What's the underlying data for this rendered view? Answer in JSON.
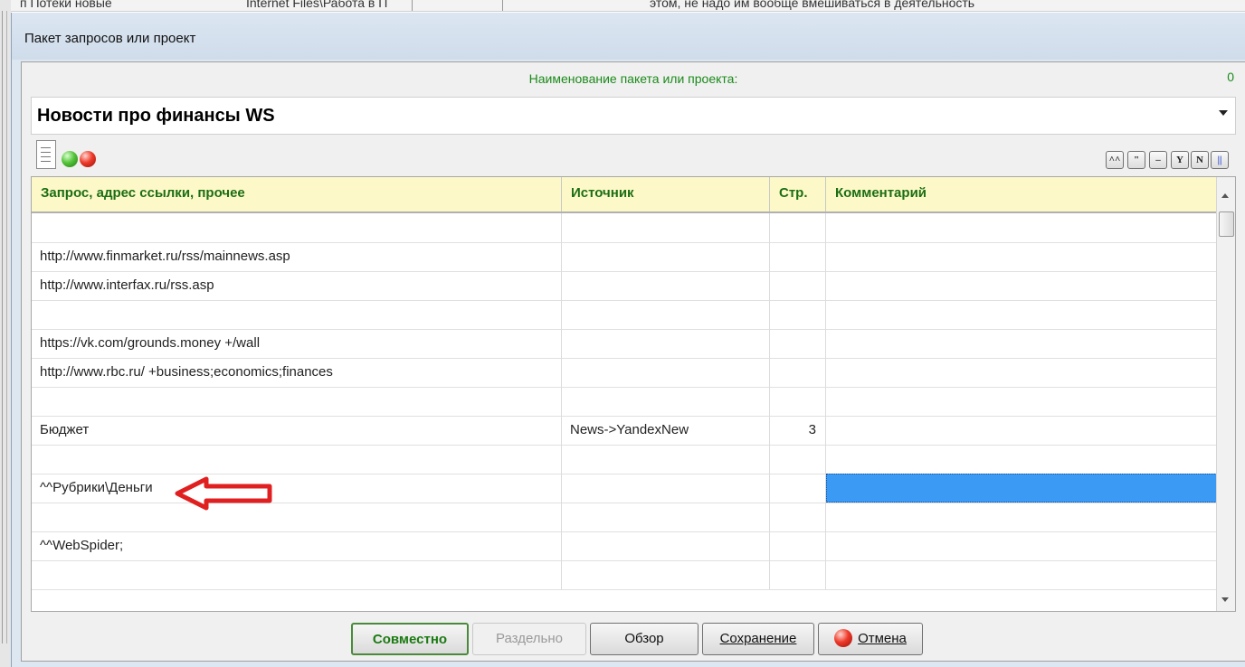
{
  "background": {
    "strip": [
      {
        "text": "п Потеки новые"
      },
      {
        "text": "Internet Files\\Работа в П"
      },
      {
        "text": "этом, не надо им вообще вмешиваться в деятельность"
      }
    ]
  },
  "window": {
    "title": "Пакет запросов или проект"
  },
  "header": {
    "name_label": "Наименование пакета или проекта:",
    "counter": "0"
  },
  "project_combo": {
    "value": "Новости про финансы WS"
  },
  "toolbar_right": [
    {
      "label": "^^",
      "icon": "caret-caret-icon"
    },
    {
      "label": "\"",
      "icon": "quote-icon"
    },
    {
      "label": "–",
      "icon": "minus-icon"
    },
    {
      "label": "Y",
      "icon": "y-icon"
    },
    {
      "label": "N",
      "icon": "n-icon"
    },
    {
      "label": "||",
      "icon": "pause-icon"
    }
  ],
  "grid": {
    "columns": [
      "Запрос, адрес ссылки, прочее",
      "Источник",
      "Стр.",
      "Комментарий"
    ],
    "rows": [
      {
        "query": "",
        "source": "",
        "page": "",
        "comment": ""
      },
      {
        "query": "http://www.finmarket.ru/rss/mainnews.asp",
        "source": "",
        "page": "",
        "comment": ""
      },
      {
        "query": "http://www.interfax.ru/rss.asp",
        "source": "",
        "page": "",
        "comment": ""
      },
      {
        "query": "",
        "source": "",
        "page": "",
        "comment": ""
      },
      {
        "query": "https://vk.com/grounds.money +/wall",
        "source": "",
        "page": "",
        "comment": ""
      },
      {
        "query": "http://www.rbc.ru/ +business;economics;finances",
        "source": "",
        "page": "",
        "comment": ""
      },
      {
        "query": "",
        "source": "",
        "page": "",
        "comment": ""
      },
      {
        "query": "Бюджет",
        "source": "News->YandexNew",
        "page": "3",
        "comment": ""
      },
      {
        "query": "",
        "source": "",
        "page": "",
        "comment": ""
      },
      {
        "query": "^^Рубрики\\Деньги",
        "source": "",
        "page": "",
        "comment": "",
        "selected_comment": true
      },
      {
        "query": "",
        "source": "",
        "page": "",
        "comment": ""
      },
      {
        "query": "^^WebSpider;",
        "source": "",
        "page": "",
        "comment": ""
      },
      {
        "query": "",
        "source": "",
        "page": "",
        "comment": ""
      }
    ]
  },
  "buttons": {
    "joint": "Совместно",
    "separate": "Раздельно",
    "browse": "Обзор",
    "save": "Сохранение",
    "cancel": "Отмена"
  },
  "colors": {
    "label_green": "#1a8a1a",
    "header_bg": "#fdf8c8",
    "selection": "#3b9bf4",
    "annotation_arrow": "#e02020"
  }
}
